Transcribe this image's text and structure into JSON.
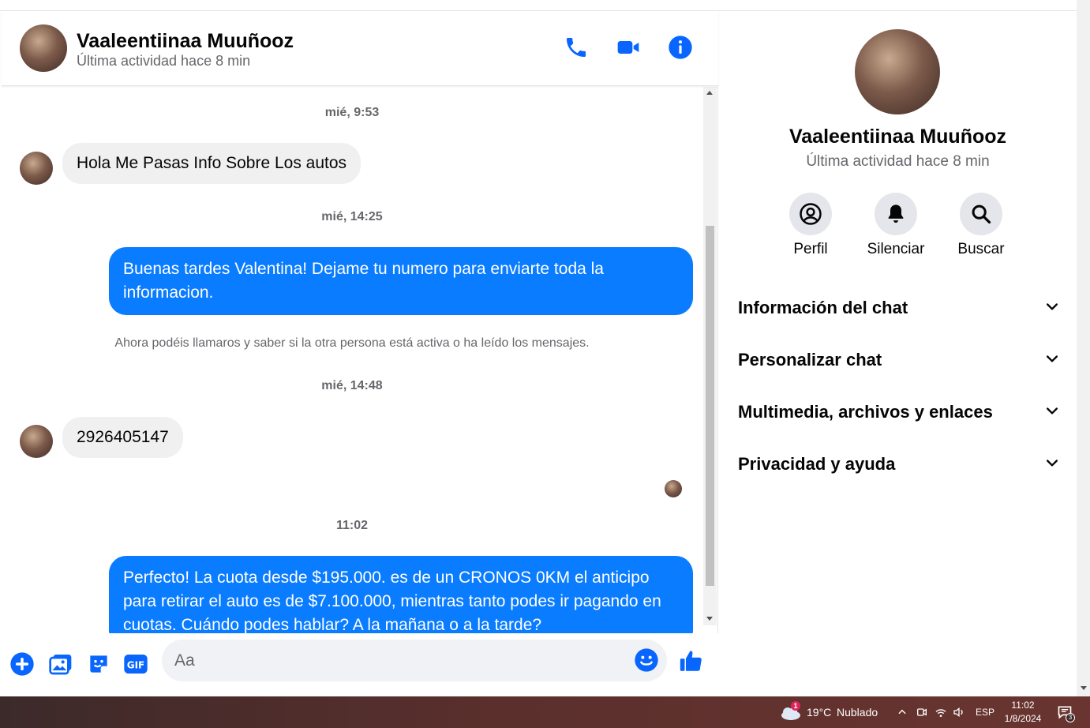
{
  "header": {
    "name": "Vaaleentiinaa Muuñooz",
    "status": "Última actividad hace 8 min"
  },
  "messages": {
    "ts1": "mié, 9:53",
    "in1": "Hola Me Pasas Info Sobre Los autos",
    "ts2": "mié, 14:25",
    "out1": "Buenas tardes Valentina! Dejame tu numero para enviarte toda la informacion.",
    "system": "Ahora podéis llamaros y saber si la otra persona está activa o ha leído los mensajes.",
    "ts3": "mié, 14:48",
    "in2": "2926405147",
    "ts4": "11:02",
    "out2": "Perfecto! La cuota desde $195.000. es de un CRONOS 0KM el anticipo para retirar el auto es de $7.100.000, mientras tanto podes ir pagando en cuotas. Cuándo podes hablar? A la mañana o a la tarde?"
  },
  "composer": {
    "placeholder": "Aa"
  },
  "info": {
    "name": "Vaaleentiinaa Muuñooz",
    "status": "Última actividad hace 8 min",
    "actions": [
      {
        "label": "Perfil"
      },
      {
        "label": "Silenciar"
      },
      {
        "label": "Buscar"
      }
    ],
    "sections": [
      {
        "label": "Información del chat"
      },
      {
        "label": "Personalizar chat"
      },
      {
        "label": "Multimedia, archivos y enlaces"
      },
      {
        "label": "Privacidad y ayuda"
      }
    ]
  },
  "taskbar": {
    "weather_badge": "1",
    "weather": "19°C",
    "weather_desc": "Nublado",
    "lang": "ESP",
    "time": "11:02",
    "date": "1/8/2024",
    "notif_count": "3"
  },
  "colors": {
    "accent": "#0a7cff",
    "icon_blue": "#0866ff",
    "incoming_bubble": "#f0f0f0"
  }
}
